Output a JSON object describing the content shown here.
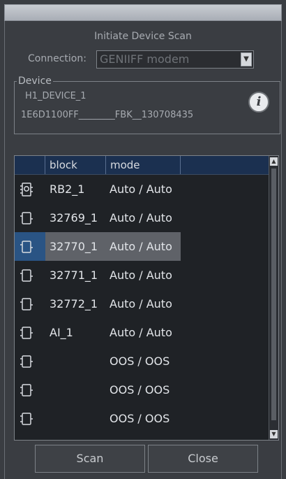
{
  "dialog": {
    "title": "Initiate Device Scan",
    "connection_label": "Connection:",
    "connection_value": "GENIIFF modem"
  },
  "device": {
    "legend": "Device",
    "name": "H1_DEVICE_1",
    "id": "1E6D1100FF________FBK__130708435"
  },
  "table": {
    "columns": [
      "block",
      "mode"
    ],
    "rows": [
      {
        "block": "RB2_1",
        "mode": "Auto / Auto",
        "icon": "resource-block-icon"
      },
      {
        "block": "32769_1",
        "mode": "Auto / Auto",
        "icon": "transducer-block-icon"
      },
      {
        "block": "32770_1",
        "mode": "Auto / Auto",
        "icon": "transducer-block-icon",
        "selected": true
      },
      {
        "block": "32771_1",
        "mode": "Auto / Auto",
        "icon": "transducer-block-icon"
      },
      {
        "block": "32772_1",
        "mode": "Auto / Auto",
        "icon": "transducer-block-icon"
      },
      {
        "block": "AI_1",
        "mode": "Auto / Auto",
        "icon": "function-block-icon"
      },
      {
        "block": "",
        "mode": "OOS / OOS",
        "icon": "function-block-icon"
      },
      {
        "block": "",
        "mode": "OOS / OOS",
        "icon": "function-block-icon"
      },
      {
        "block": "",
        "mode": "OOS / OOS",
        "icon": "function-block-icon"
      }
    ]
  },
  "buttons": {
    "scan": "Scan",
    "close": "Close"
  },
  "colors": {
    "background": "#3a3d42",
    "header": "#1b3050",
    "selected_icon": "#2a5484",
    "selected_row": "#5f6268"
  }
}
